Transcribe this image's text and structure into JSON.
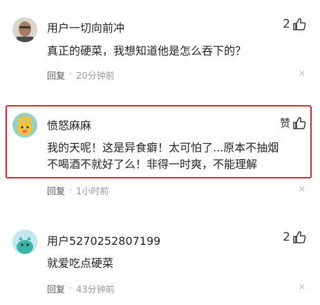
{
  "comments": [
    {
      "username": "用户一切向前冲",
      "likes": "2",
      "text": "真正的硬菜，我想知道他是怎么吞下的？",
      "reply": "回复",
      "dot": "·",
      "time": "20分钟前",
      "avatar": "man-photo-avatar"
    },
    {
      "username": "愤怒麻麻",
      "likes": "赞",
      "text_line1": "我的天呢！这是异食癖！太可怕了...原本不抽烟",
      "text_line2": "不喝酒不就好了么！非得一时爽，不能理解",
      "reply": "回复",
      "dot": "·",
      "time": "1小时前",
      "avatar": "cartoon-avatar-yellow",
      "highlighted": true
    },
    {
      "username": "用户5270252807199",
      "likes": "2",
      "text": "就爱吃点硬菜",
      "reply": "回复",
      "dot": "·",
      "time": "43分钟前",
      "avatar": "cartoon-avatar-teal"
    }
  ],
  "close_glyph": "×",
  "colors": {
    "highlight_border": "#e02424",
    "meta_text": "#999999",
    "body_text": "#222222"
  }
}
